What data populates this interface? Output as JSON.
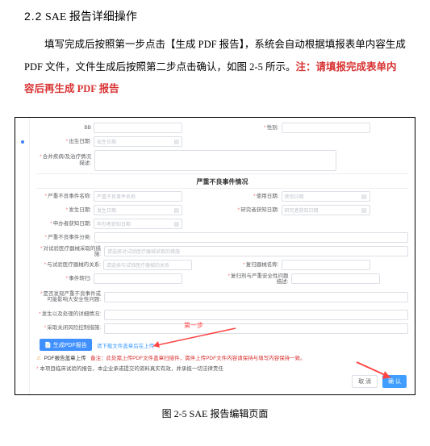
{
  "doc": {
    "heading_num": "2.2",
    "heading_text": "SAE 报告详细操作",
    "para": "填写完成后按照第一步点击【生成 PDF 报告】，系统会自动根据填报表单内容生成 PDF 文件，文件生成后按照第二步点击确认，如图 2-5 所示。",
    "para_highlight": "注：请填报完成表单内容后再生成 PDF 报告",
    "caption": "图 2-5   SAE 报告编辑页面"
  },
  "annot": {
    "step1": "第一步"
  },
  "form": {
    "f_top_left": "BB",
    "f_top_right": "性别:",
    "birth": "出生日期:",
    "birth_ph": "出生日期",
    "merge_disease": "合并疾病/及治疗情况描述:",
    "section_title": "严重不良事件情况",
    "sae_name": "严重不良事件名称:",
    "sae_name_ph": "严重不良事件名称",
    "use_date": "使用日期:",
    "use_date_ph": "使用日期",
    "happen_date": "发生日期:",
    "happen_date_ph": "发生日期",
    "research_know": "研究者获知日期:",
    "research_know_ph": "研究者获知日期",
    "applicant_know": "申办者获知日期:",
    "applicant_know_ph": "申办者获知日期",
    "seriousness": "严重不良事件分类:",
    "relation_dev": "对试验医疗器械采取的措施:",
    "relation_dev_ph": "请选择对试验医疗器械采取的措施",
    "relation_other_dev": "与试验医疗器械的关系:",
    "relation_other_dev_ph": "请选择与试验医疗器械的关系",
    "outcome": "事件转归:",
    "recover_date": "复归器械名称:",
    "seq_recover": "复归剂与严重安全性问题描述:",
    "is_major_safety": "是否发现严重不良事件或可能影响大安全性问题:",
    "last_treat": "发生以及处理的详细情况:",
    "case_number": "采取关闭风险控制措施:",
    "gen_pdf_btn": "生成PDF报告",
    "download_tip": "请下载文件盖章后在上传",
    "warn1_label": "PDF报告盖章上传",
    "warn1_red": "备注：此处需上传PDF文件盖章扫描件，需伴上传PDF文件内容请保持与填写内容保持一致。",
    "warn2": "本项目临床试验的报告，本企业承诺提交的资料真实有效，并承担一切法律责任",
    "cancel": "取 消",
    "confirm": "确 认"
  }
}
